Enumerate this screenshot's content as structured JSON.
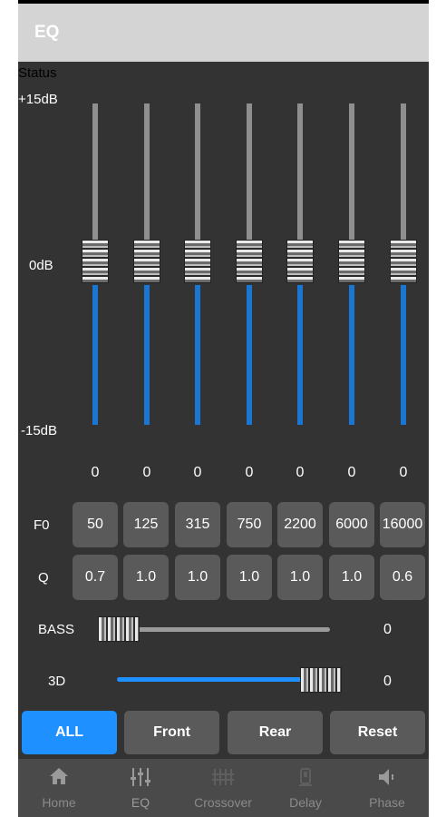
{
  "header": {
    "title": "EQ"
  },
  "status_label": "Status",
  "scale": {
    "top": "+15dB",
    "mid": "0dB",
    "bottom": "-15dB"
  },
  "bands": [
    {
      "value": "0",
      "f0": "50",
      "q": "0.7"
    },
    {
      "value": "0",
      "f0": "125",
      "q": "1.0"
    },
    {
      "value": "0",
      "f0": "315",
      "q": "1.0"
    },
    {
      "value": "0",
      "f0": "750",
      "q": "1.0"
    },
    {
      "value": "0",
      "f0": "2200",
      "q": "1.0"
    },
    {
      "value": "0",
      "f0": "6000",
      "q": "1.0"
    },
    {
      "value": "0",
      "f0": "16000",
      "q": "0.6"
    }
  ],
  "row_labels": {
    "f0": "F0",
    "q": "Q"
  },
  "bass": {
    "label": "BASS",
    "value": "0",
    "level": 0
  },
  "three_d": {
    "label": "3D",
    "value": "0",
    "level": 1
  },
  "buttons": {
    "all": "ALL",
    "front": "Front",
    "rear": "Rear",
    "reset": "Reset"
  },
  "nav": [
    {
      "label": "Home",
      "icon": "home-icon"
    },
    {
      "label": "EQ",
      "icon": "eq-sliders-icon"
    },
    {
      "label": "Crossover",
      "icon": "crossover-icon"
    },
    {
      "label": "Delay",
      "icon": "delay-icon"
    },
    {
      "label": "Phase",
      "icon": "speaker-icon"
    }
  ],
  "colors": {
    "accent": "#1e90ff",
    "track_blue": "#1976d2",
    "panel": "#333333",
    "header": "#d4d4d4"
  }
}
